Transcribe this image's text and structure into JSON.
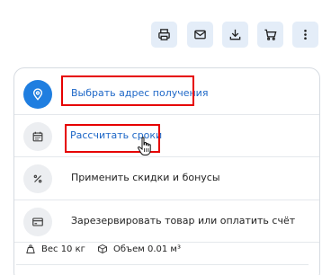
{
  "toolbar": {
    "buttons": [
      {
        "name": "print",
        "icon": "printer-icon"
      },
      {
        "name": "email",
        "icon": "mail-icon"
      },
      {
        "name": "download",
        "icon": "download-icon"
      },
      {
        "name": "cart",
        "icon": "cart-icon"
      },
      {
        "name": "more",
        "icon": "more-vertical-icon"
      }
    ]
  },
  "options": [
    {
      "label": "Выбрать адрес получения",
      "icon": "location-pin-icon",
      "link": true,
      "active": true
    },
    {
      "label": "Рассчитать сроки",
      "icon": "calendar-icon",
      "link": true,
      "active": false
    },
    {
      "label": "Применить скидки и бонусы",
      "icon": "percent-icon",
      "link": false,
      "active": false
    },
    {
      "label": "Зарезервировать товар или оплатить счёт",
      "icon": "credit-card-icon",
      "link": false,
      "active": false
    }
  ],
  "meta": {
    "weight": "Вес 10 кг",
    "volume": "Объем 0.01 м³"
  },
  "colors": {
    "accent": "#1f7ee0",
    "link": "#1d67c7",
    "highlight": "#e60000",
    "button_bg": "#e4edf8"
  }
}
